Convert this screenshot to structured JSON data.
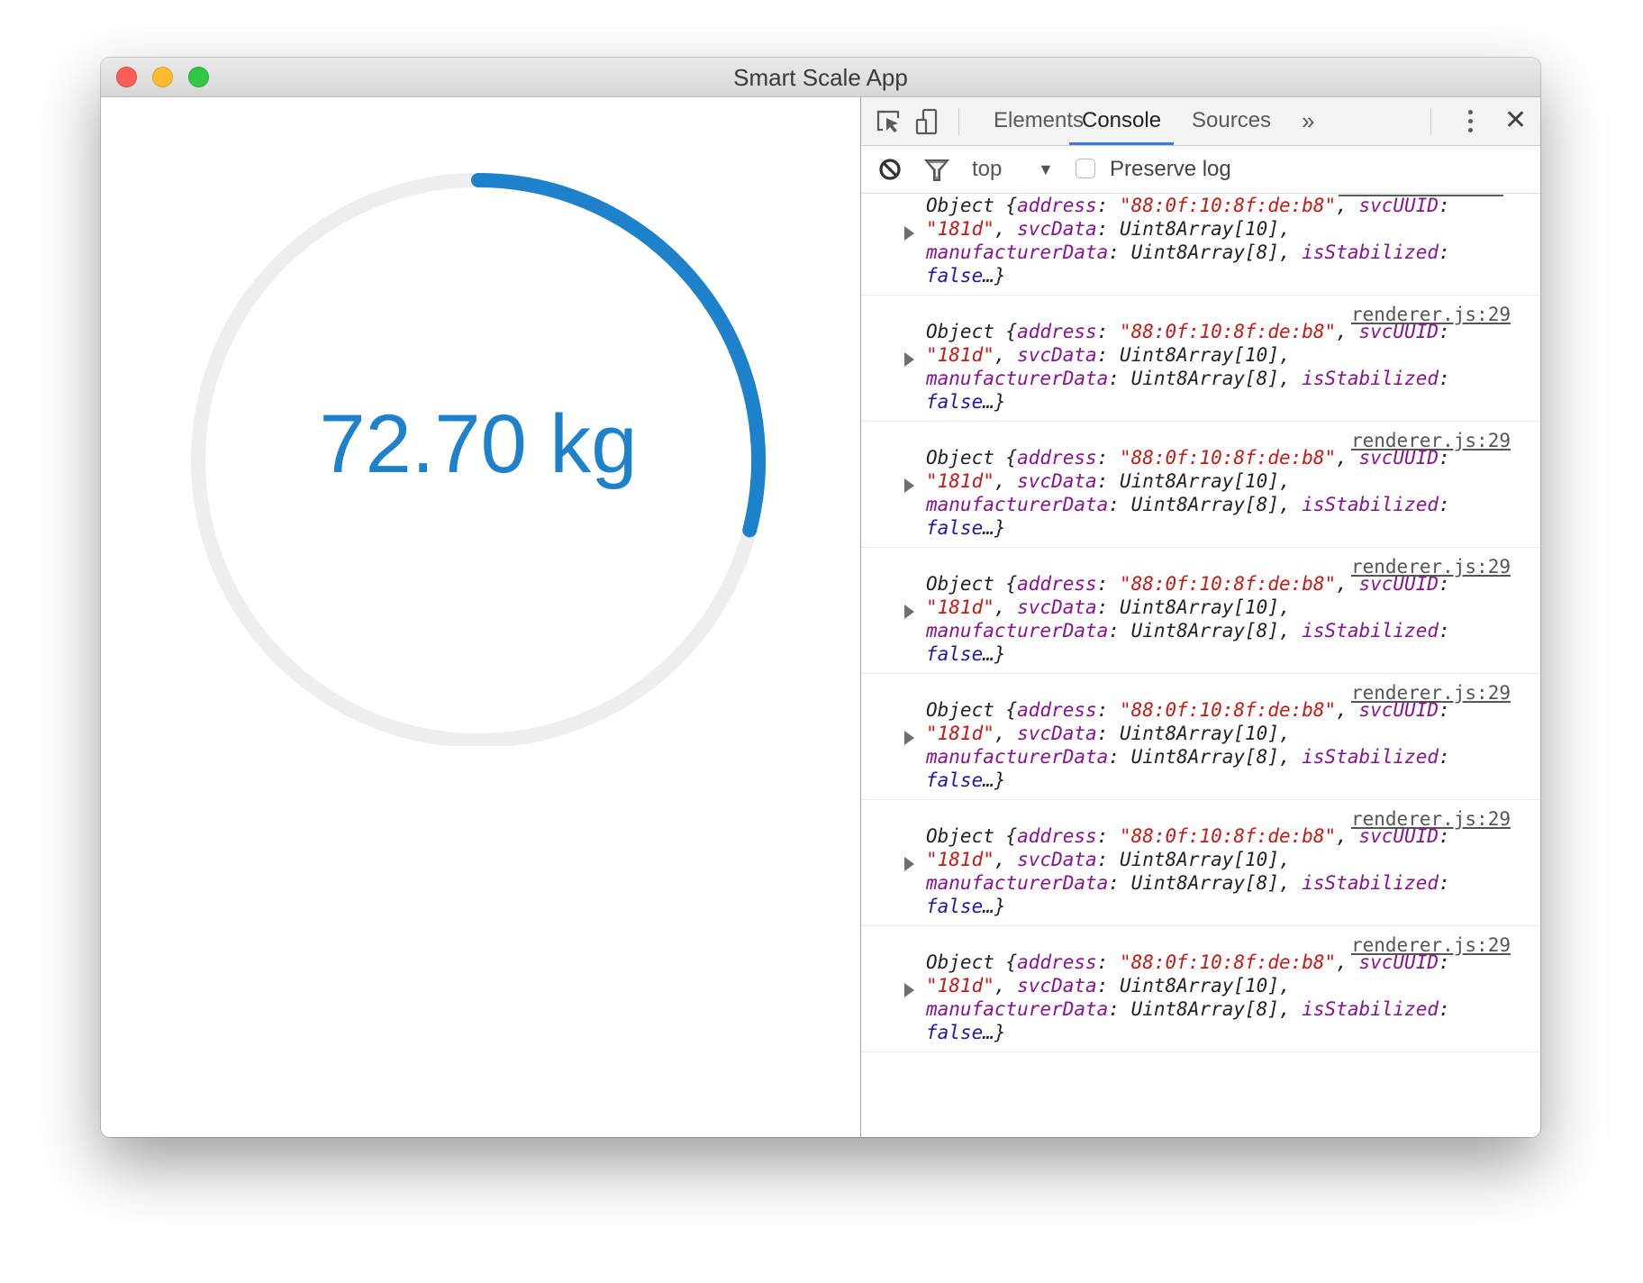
{
  "window": {
    "title": "Smart Scale App"
  },
  "app": {
    "weight_display": "72.70 kg",
    "gauge": {
      "progress_fraction": 0.29,
      "track_color": "#eeeeee",
      "fill_color": "#1e81cb"
    }
  },
  "devtools": {
    "tabs": [
      {
        "label": "Elements",
        "active": false
      },
      {
        "label": "Console",
        "active": true
      },
      {
        "label": "Sources",
        "active": false
      }
    ],
    "more_tabs_label": "»",
    "toolbar_icons": [
      "inspect-element-icon",
      "device-toolbar-icon",
      "kebab-menu-icon",
      "close-icon"
    ],
    "filter": {
      "context": "top",
      "preserve_log_label": "Preserve log",
      "preserve_log_checked": false
    },
    "entry_template": {
      "prefix": "Object {",
      "address_key": "address",
      "address_value": "\"88:0f:10:8f:de:b8\"",
      "svcuuid_key": "svcUUID",
      "svcuuid_value": "\"181d\"",
      "svcdata_key": "svcData",
      "svcdata_value": "Uint8Array[10]",
      "mfr_key": "manufacturerData",
      "mfr_value": "Uint8Array[8]",
      "stab_key": "isStabilized",
      "stab_value": "false",
      "suffix": "…}"
    },
    "console_entries": [
      {
        "source": ""
      },
      {
        "source": "renderer.js:29"
      },
      {
        "source": "renderer.js:29"
      },
      {
        "source": "renderer.js:29"
      },
      {
        "source": "renderer.js:29"
      },
      {
        "source": "renderer.js:29"
      },
      {
        "source": "renderer.js:29"
      }
    ],
    "prompt_symbol": "›",
    "drawer": {
      "tab_label": "Console"
    },
    "colors": {
      "accent": "#3879d9",
      "key": "#881391",
      "string": "#c41a16",
      "boolean": "#1a1aa6"
    }
  }
}
